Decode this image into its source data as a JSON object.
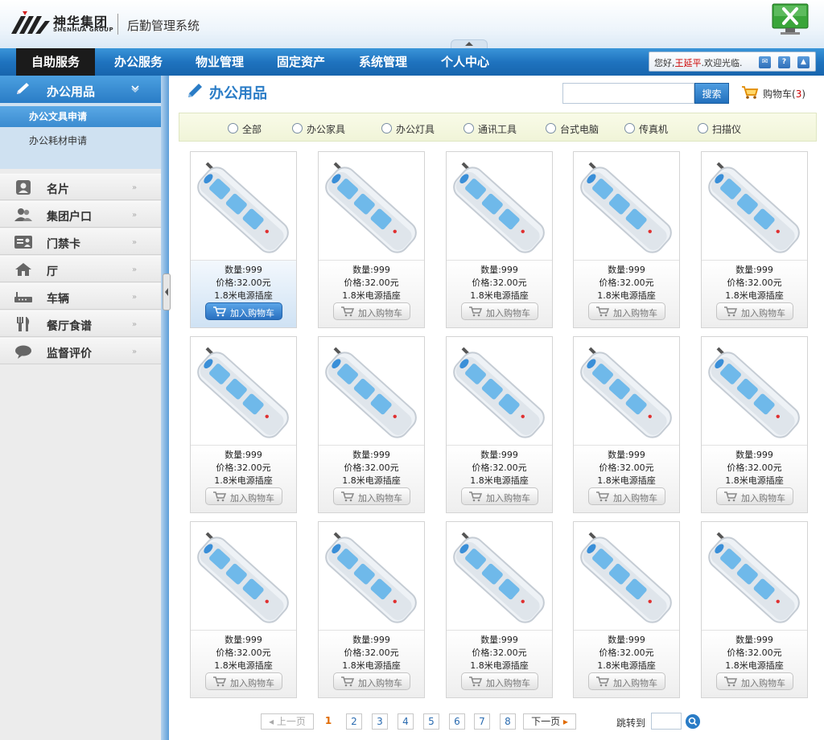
{
  "header": {
    "logo_name": "神华集团",
    "logo_sub": "SHENHUA GROUP",
    "system_name": "后勤管理系统",
    "exit_icon": "exit-icon"
  },
  "nav": {
    "items": [
      {
        "label": "自助服务",
        "active": true
      },
      {
        "label": "办公服务",
        "active": false
      },
      {
        "label": "物业管理",
        "active": false
      },
      {
        "label": "固定资产",
        "active": false
      },
      {
        "label": "系统管理",
        "active": false
      },
      {
        "label": "个人中心",
        "active": false
      }
    ],
    "welcome_prefix": "您好,",
    "username": "王延平",
    "welcome_suffix": ".欢迎光临.",
    "icons": [
      "mail-icon",
      "help-icon",
      "up-icon"
    ]
  },
  "sidebar": {
    "section_title": "办公用品",
    "sub_items": [
      {
        "label": "办公文具申请",
        "active": true
      },
      {
        "label": "办公耗材申请",
        "active": false
      }
    ],
    "items": [
      {
        "label": "名片",
        "icon": "card-icon"
      },
      {
        "label": "集团户口",
        "icon": "users-icon"
      },
      {
        "label": "门禁卡",
        "icon": "badge-icon"
      },
      {
        "label": "厅",
        "icon": "home-icon"
      },
      {
        "label": "车辆",
        "icon": "vehicle-icon"
      },
      {
        "label": "餐厅食谱",
        "icon": "dining-icon"
      },
      {
        "label": "监督评价",
        "icon": "comment-icon"
      }
    ]
  },
  "main": {
    "title": "办公用品",
    "search_button": "搜索",
    "search_value": "",
    "cart_label": "购物车",
    "cart_open": "(",
    "cart_count": "3",
    "cart_close": ")",
    "filters": [
      "全部",
      "办公家具",
      "办公灯具",
      "通讯工具",
      "台式电脑",
      "传真机",
      "扫描仪"
    ]
  },
  "products": [
    {
      "qty": "数量:999",
      "price": "价格:32.00元",
      "name": "1.8米电源插座",
      "button": "加入购物车"
    },
    {
      "qty": "数量:999",
      "price": "价格:32.00元",
      "name": "1.8米电源插座",
      "button": "加入购物车"
    },
    {
      "qty": "数量:999",
      "price": "价格:32.00元",
      "name": "1.8米电源插座",
      "button": "加入购物车"
    },
    {
      "qty": "数量:999",
      "price": "价格:32.00元",
      "name": "1.8米电源插座",
      "button": "加入购物车"
    },
    {
      "qty": "数量:999",
      "price": "价格:32.00元",
      "name": "1.8米电源插座",
      "button": "加入购物车"
    },
    {
      "qty": "数量:999",
      "price": "价格:32.00元",
      "name": "1.8米电源插座",
      "button": "加入购物车"
    },
    {
      "qty": "数量:999",
      "price": "价格:32.00元",
      "name": "1.8米电源插座",
      "button": "加入购物车"
    },
    {
      "qty": "数量:999",
      "price": "价格:32.00元",
      "name": "1.8米电源插座",
      "button": "加入购物车"
    },
    {
      "qty": "数量:999",
      "price": "价格:32.00元",
      "name": "1.8米电源插座",
      "button": "加入购物车"
    },
    {
      "qty": "数量:999",
      "price": "价格:32.00元",
      "name": "1.8米电源插座",
      "button": "加入购物车"
    },
    {
      "qty": "数量:999",
      "price": "价格:32.00元",
      "name": "1.8米电源插座",
      "button": "加入购物车"
    },
    {
      "qty": "数量:999",
      "price": "价格:32.00元",
      "name": "1.8米电源插座",
      "button": "加入购物车"
    },
    {
      "qty": "数量:999",
      "price": "价格:32.00元",
      "name": "1.8米电源插座",
      "button": "加入购物车"
    },
    {
      "qty": "数量:999",
      "price": "价格:32.00元",
      "name": "1.8米电源插座",
      "button": "加入购物车"
    },
    {
      "qty": "数量:999",
      "price": "价格:32.00元",
      "name": "1.8米电源插座",
      "button": "加入购物车"
    }
  ],
  "highlighted_product": 0,
  "pagination": {
    "prev": "上一页",
    "pages": [
      "1",
      "2",
      "3",
      "4",
      "5",
      "6",
      "7",
      "8"
    ],
    "current": "1",
    "next": "下一页",
    "jump_label": "跳转到",
    "jump_value": ""
  },
  "colors": {
    "nav_blue": "#1f73bf",
    "active_nav": "#1b1b1b",
    "accent_blue": "#2a7cc6",
    "highlight_red": "#cc0000",
    "current_page": "#e06a00"
  }
}
